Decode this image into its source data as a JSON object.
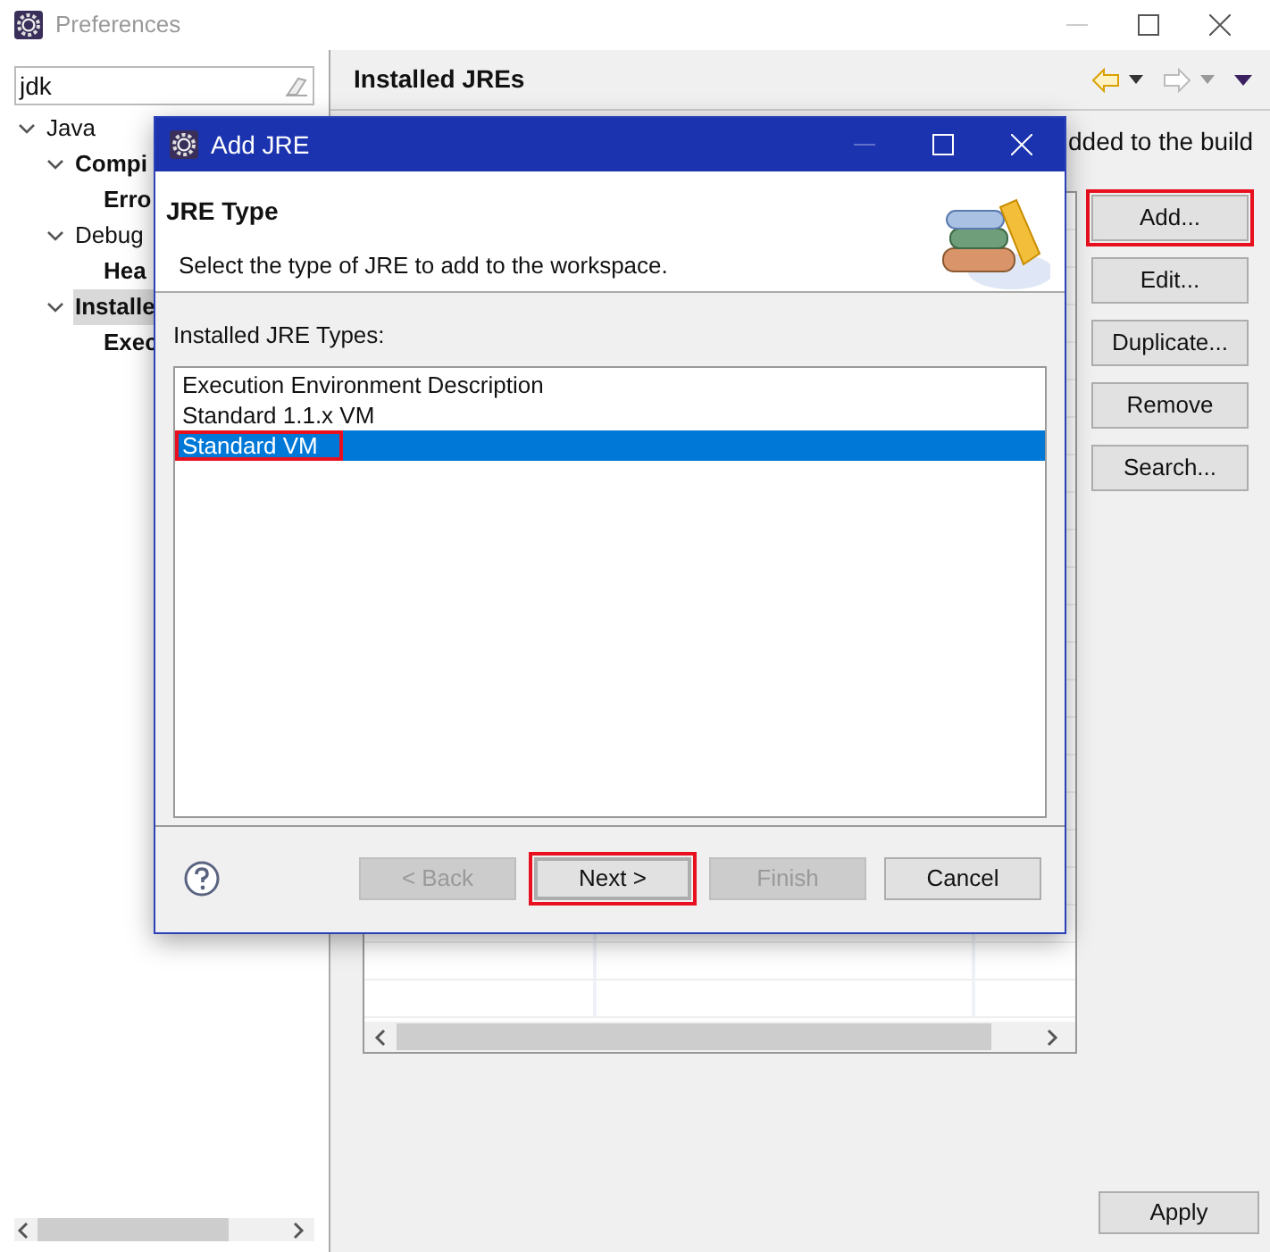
{
  "window": {
    "title": "Preferences"
  },
  "filter": {
    "value": "jdk"
  },
  "tree": [
    {
      "label": "Java",
      "bold": false,
      "selected": false,
      "expanded": true,
      "children": [
        {
          "label": "Compi",
          "bold": true,
          "selected": false,
          "expanded": true,
          "children": [
            {
              "label": "Erro",
              "bold": true,
              "selected": false
            }
          ]
        },
        {
          "label": "Debug",
          "bold": false,
          "selected": false,
          "expanded": true,
          "children": [
            {
              "label": "Hea",
              "bold": true,
              "selected": false
            }
          ]
        },
        {
          "label": "Installe",
          "bold": true,
          "selected": true,
          "expanded": true,
          "children": [
            {
              "label": "Exec",
              "bold": true,
              "selected": false
            }
          ]
        }
      ]
    }
  ],
  "page": {
    "title": "Installed JREs",
    "description": "dded to the build",
    "buttons": [
      {
        "label": "Add...",
        "highlighted": true
      },
      {
        "label": "Edit...",
        "highlighted": false
      },
      {
        "label": "Duplicate...",
        "highlighted": false
      },
      {
        "label": "Remove",
        "highlighted": false
      },
      {
        "label": "Search...",
        "highlighted": false
      }
    ],
    "apply": "Apply"
  },
  "dialog": {
    "title": "Add JRE",
    "heading": "JRE Type",
    "description": "Select the type of JRE to add to the workspace.",
    "list_label": "Installed JRE Types:",
    "types": [
      {
        "label": "Execution Environment Description",
        "selected": false,
        "highlighted": false
      },
      {
        "label": "Standard 1.1.x VM",
        "selected": false,
        "highlighted": false
      },
      {
        "label": "Standard VM",
        "selected": true,
        "highlighted": true
      }
    ],
    "buttons": [
      {
        "label": "< Back",
        "disabled": true,
        "default": false,
        "highlighted": false
      },
      {
        "label": "Next >",
        "disabled": false,
        "default": true,
        "highlighted": true
      },
      {
        "label": "Finish",
        "disabled": true,
        "default": false,
        "highlighted": false
      },
      {
        "label": "Cancel",
        "disabled": false,
        "default": false,
        "highlighted": false
      }
    ]
  }
}
